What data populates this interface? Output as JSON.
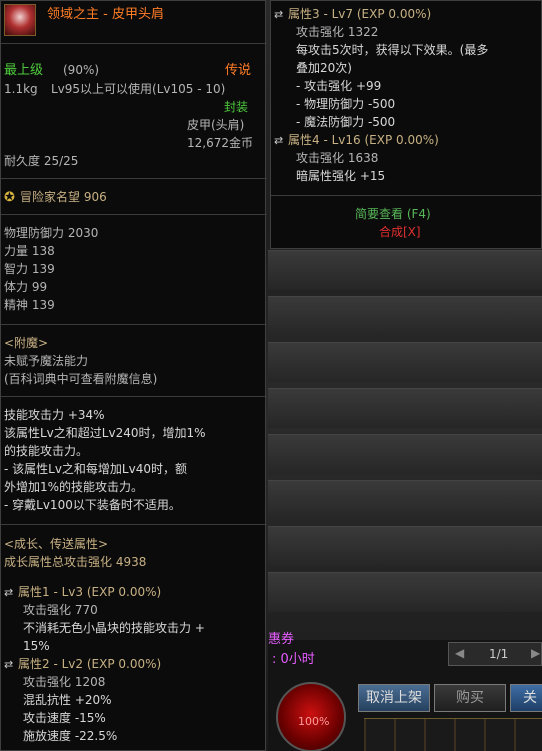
{
  "item": {
    "name": "领域之主 - 皮甲头肩",
    "grade": "最上级",
    "grade_pct": "(90%)",
    "rarity": "传说",
    "weight": "1.1kg",
    "level_req": "Lv95以上可以使用(Lv105 - 10)",
    "sealed": "封装",
    "slot_type": "皮甲(头肩)",
    "price": "12,672金币",
    "durability": "耐久度 25/25"
  },
  "fame": {
    "label": "冒险家名望",
    "value": "906"
  },
  "stats": [
    "物理防御力 2030",
    "力量 138",
    "智力 139",
    "体力 99",
    "精神 139"
  ],
  "enchant": {
    "title": "<附魔>",
    "line1": "未赋予魔法能力",
    "line2": "(百科词典中可查看附魔信息)"
  },
  "skill_text": [
    "技能攻击力 +34%",
    "该属性Lv之和超过Lv240时，增加1%",
    "的技能攻击力。",
    "- 该属性Lv之和每增加Lv40时，额",
    "外增加1%的技能攻击力。",
    "- 穿戴Lv100以下装备时不适用。"
  ],
  "growth": {
    "title": "<成长、传送属性>",
    "total": "成长属性总攻击强化 4938",
    "attr1": {
      "header": "属性1 - Lv3 (EXP 0.00%)",
      "atk": "攻击强化 770",
      "desc1": "不消耗无色小晶块的技能攻击力 +",
      "desc2": "15%"
    },
    "attr2": {
      "header": "属性2 - Lv2 (EXP 0.00%)",
      "atk": "攻击强化 1208",
      "lines": [
        "混乱抗性 +20%",
        "攻击速度 -15%",
        "施放速度 -22.5%"
      ]
    },
    "attr3": {
      "header": "属性3 - Lv7 (EXP 0.00%)",
      "atk": "攻击强化 1322",
      "lines": [
        "每攻击5次时，获得以下效果。(最多",
        "叠加20次)",
        "- 攻击强化 +99",
        "- 物理防御力 -500",
        "- 魔法防御力 -500"
      ]
    },
    "attr4": {
      "header": "属性4 - Lv16 (EXP 0.00%)",
      "atk": "攻击强化 1638",
      "lines": [
        "暗属性强化 +15"
      ]
    }
  },
  "actions": {
    "brief_view": "简要查看 (F4)",
    "synthesize": "合成[X]"
  },
  "game_ui": {
    "price_label": "惠券",
    "time_label": ": 0小时",
    "pager": "1/1",
    "orb_pct": "100%",
    "cancel_listing": "取消上架",
    "buy": "购买",
    "close": "关"
  },
  "colors": {
    "legend_orange": "#ff7d26",
    "name_orange": "#ff7d26",
    "gold_text": "#c8b184",
    "green_text": "#4ecb3c",
    "red_text": "#e03030"
  }
}
